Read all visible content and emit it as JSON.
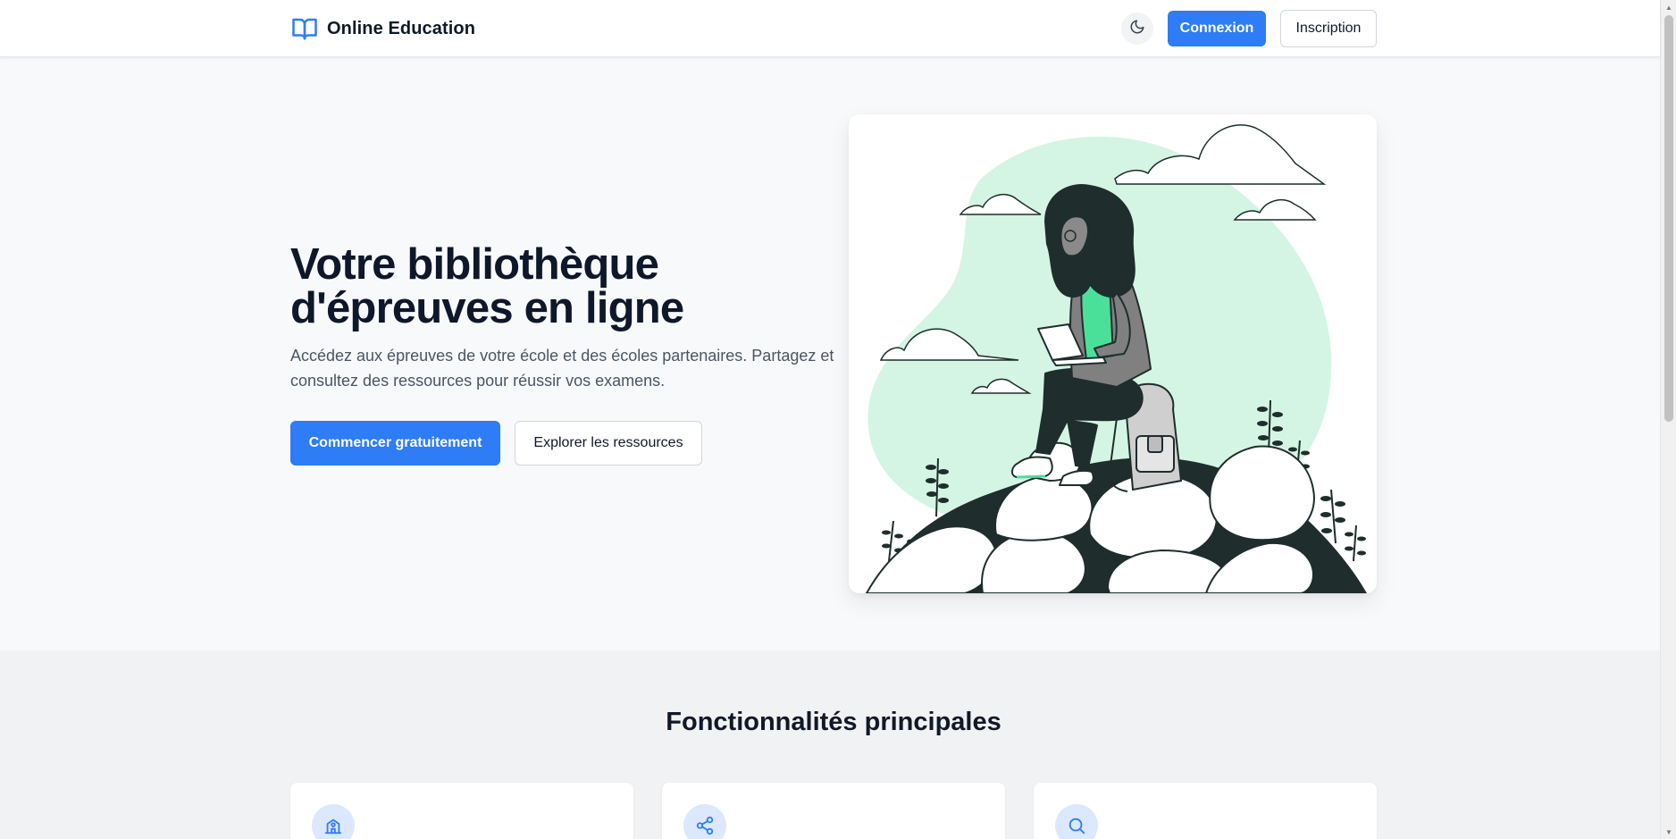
{
  "header": {
    "brand_name": "Online Education",
    "login_label": "Connexion",
    "signup_label": "Inscription"
  },
  "hero": {
    "title_line1": "Votre bibliothèque",
    "title_line2": "d'épreuves en ligne",
    "subtitle": "Accédez aux épreuves de votre école et des écoles partenaires. Partagez et consultez des ressources pour réussir vos examens.",
    "cta_primary": "Commencer gratuitement",
    "cta_secondary": "Explorer les ressources"
  },
  "features": {
    "title": "Fonctionnalités principales",
    "cards": [
      {
        "icon": "school-icon"
      },
      {
        "icon": "share-icon"
      },
      {
        "icon": "search-icon"
      }
    ]
  },
  "colors": {
    "accent": "#2e7cf6",
    "text": "#111827",
    "blob": "#d4f5e3",
    "dark": "#1f2d2d",
    "shirt": "#4be09a"
  }
}
